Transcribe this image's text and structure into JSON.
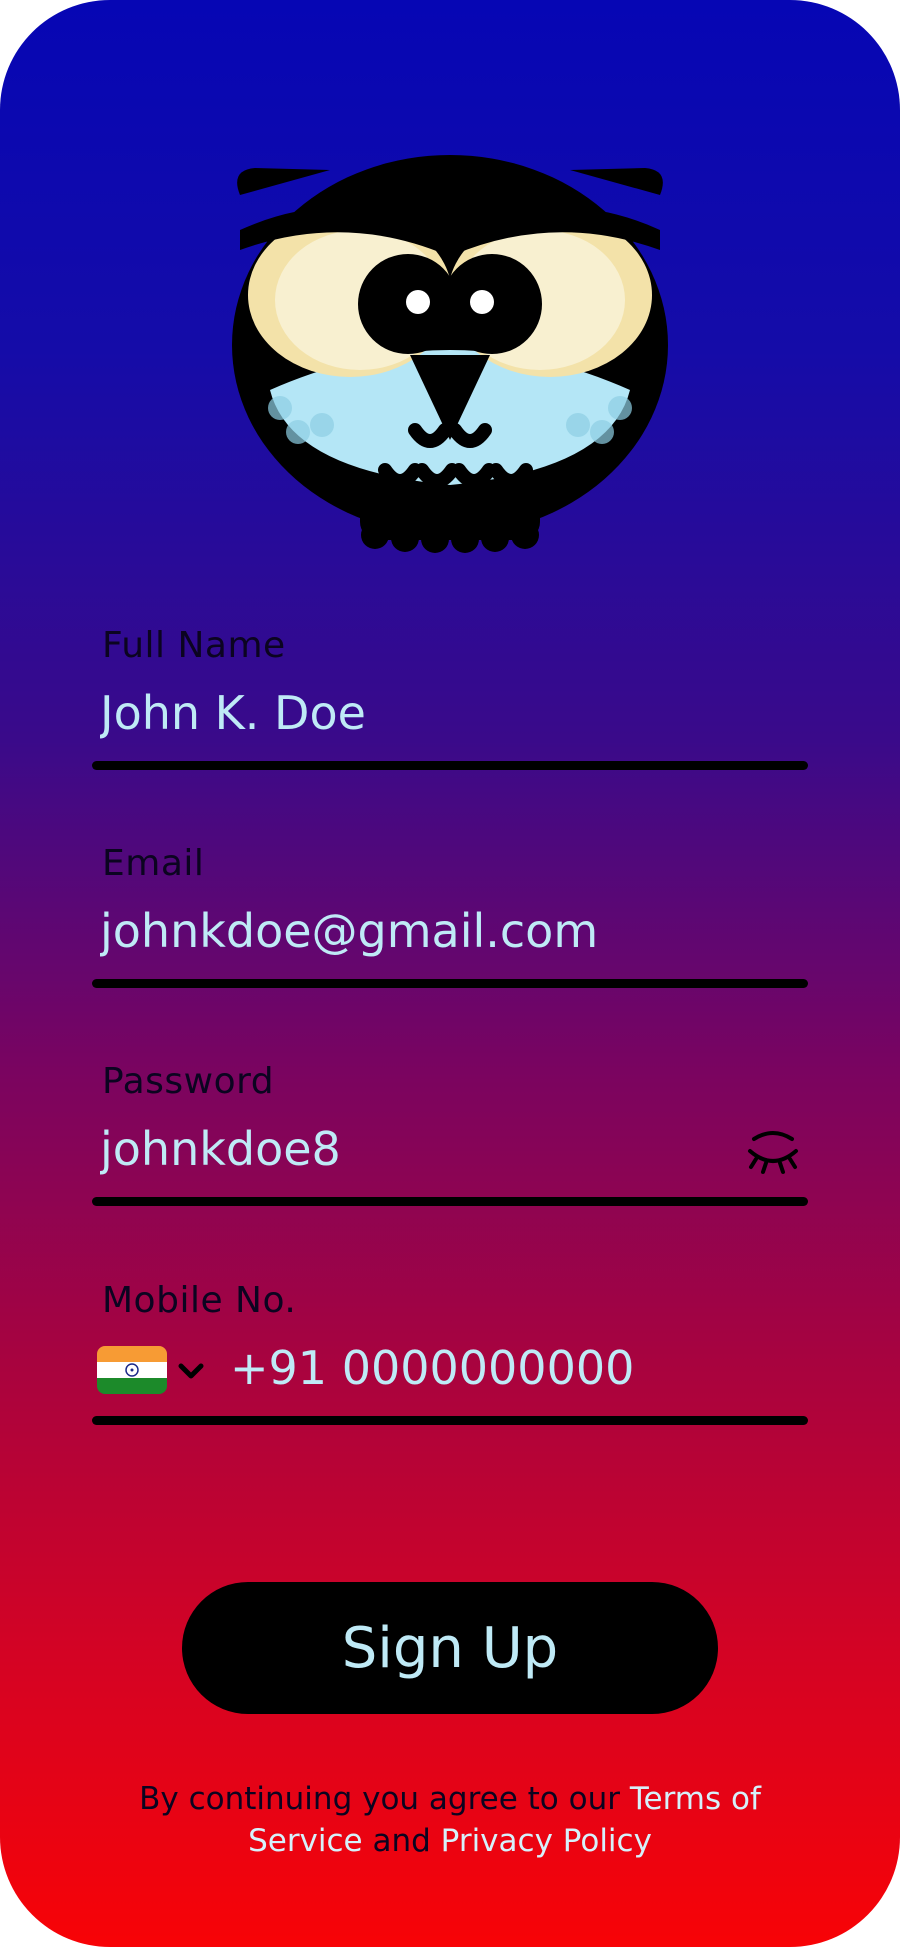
{
  "form": {
    "full_name": {
      "label": "Full Name",
      "value": "John K. Doe"
    },
    "email": {
      "label": "Email",
      "value": "johnkdoe@gmail.com"
    },
    "password": {
      "label": "Password",
      "value": "johnkdoe8",
      "toggle_icon": "eye-closed-icon"
    },
    "mobile": {
      "label": "Mobile No.",
      "country_flag": "india-flag-icon",
      "value": "+91 0000000000"
    }
  },
  "signup_button": {
    "label": "Sign Up"
  },
  "legal": {
    "prefix": "By continuing you agree to our ",
    "terms": "Terms of Service",
    "conjunction": " and ",
    "privacy": "Privacy Policy"
  },
  "colors": {
    "gradient_top": "#0606b4",
    "gradient_bottom": "#f80306",
    "input_text": "#bfeaf6",
    "label_text": "#0b0420",
    "button_bg": "#000000"
  }
}
